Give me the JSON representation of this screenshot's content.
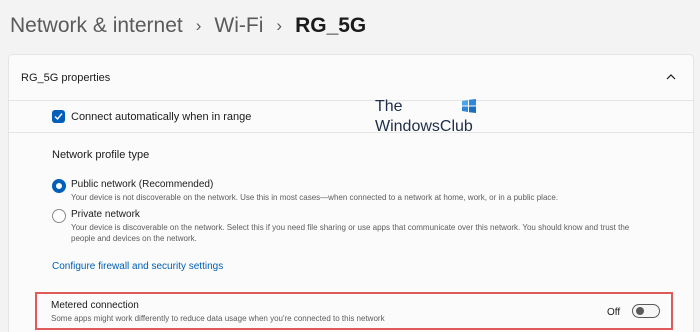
{
  "breadcrumb": {
    "items": [
      "Network & internet",
      "Wi-Fi"
    ],
    "current": "RG_5G",
    "separator": "›"
  },
  "properties_card": {
    "title": "RG_5G properties",
    "expanded": true
  },
  "auto_connect": {
    "label": "Connect automatically when in range",
    "checked": true
  },
  "profile": {
    "title": "Network profile type",
    "options": [
      {
        "title": "Public network (Recommended)",
        "description": "Your device is not discoverable on the network. Use this in most cases—when connected to a network at home, work, or in a public place.",
        "selected": true
      },
      {
        "title": "Private network",
        "description_line1": "Your device is discoverable on the network. Select this if you need file sharing or use apps that communicate over this network. You should know and trust the",
        "description_line2": "people and devices on the network.",
        "selected": false
      }
    ],
    "firewall_link": "Configure firewall and security settings"
  },
  "watermark": {
    "line1": "The",
    "line2": "WindowsClub"
  },
  "metered": {
    "title": "Metered connection",
    "description": "Some apps might work differently to reduce data usage when you're connected to this network",
    "state_label": "Off",
    "on": false
  },
  "colors": {
    "accent": "#005fb8",
    "highlight_border": "#e05a5a",
    "background": "#f3f3f3",
    "card": "#fbfbfb"
  }
}
